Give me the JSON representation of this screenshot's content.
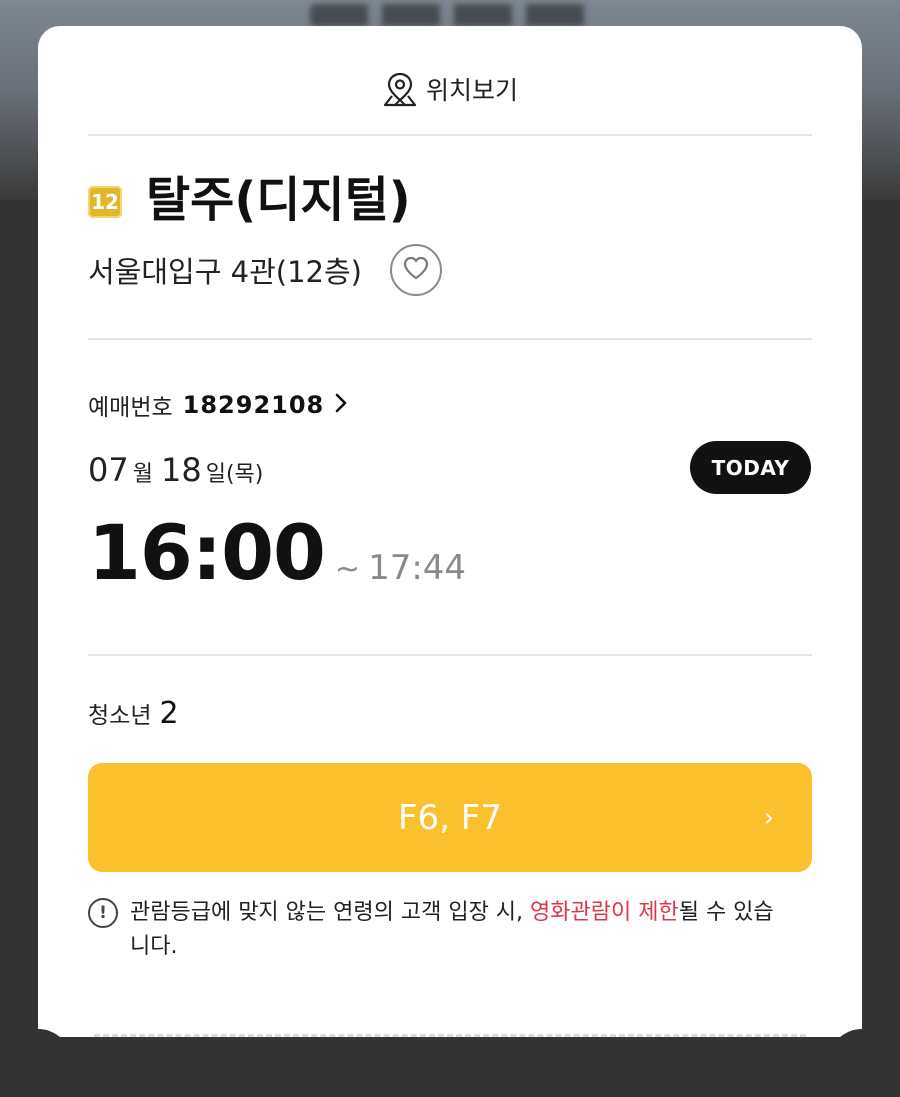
{
  "header": {
    "location_label": "위치보기"
  },
  "movie": {
    "rating": "12",
    "title": "탈주(디지털)",
    "theater": "서울대입구 4관(12층)"
  },
  "booking": {
    "label": "예매번호",
    "number": "18292108"
  },
  "date": {
    "month": "07",
    "month_unit": "월",
    "day": "18",
    "day_unit": "일",
    "weekday": "(목)",
    "today_badge": "TODAY"
  },
  "showtime": {
    "start": "16:00",
    "separator": "~",
    "end": "17:44"
  },
  "audience": {
    "type": "청소년",
    "count": "2"
  },
  "seats": {
    "label": "F6, F7",
    "chevron": "›"
  },
  "notice": {
    "icon_glyph": "!",
    "text_before": "관람등급에 맞지 않는 연령의 고객 입장 시, ",
    "text_highlight": "영화관람이 제한",
    "text_after": "될 수 있습니다."
  },
  "colors": {
    "accent_yellow": "#fbc02d",
    "rating_badge": "#e2b52c",
    "warning_red": "#e0344a",
    "today_badge_bg": "#111111"
  }
}
